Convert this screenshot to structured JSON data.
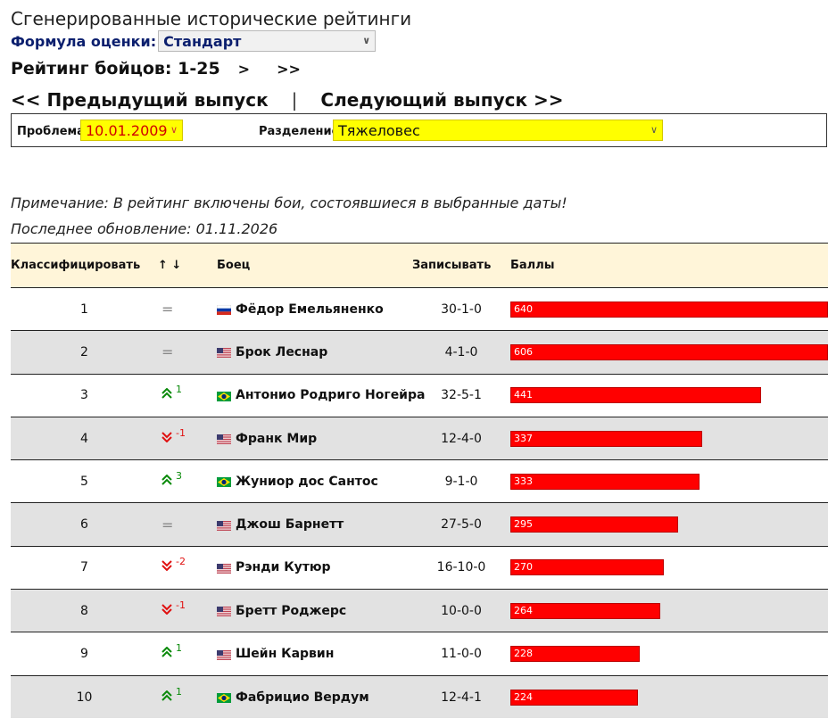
{
  "page": {
    "title": "Сгенерированные исторические рейтинги",
    "formula_label": "Формула оценки:",
    "formula_value": "Стандарт",
    "ranking_title": "Рейтинг бойцов: 1-25",
    "nav_next": ">",
    "nav_last": ">>",
    "prev_issue": "<< Предыдущий выпуск",
    "separator": "|",
    "next_issue": "Следующий выпуск >>"
  },
  "filters": {
    "issue_label": "Проблема",
    "issue_value": "10.01.2009",
    "division_label": "Разделение",
    "division_value": "Тяжеловес"
  },
  "notes": {
    "note": "Примечание: В рейтинг включены бои, состоявшиеся в выбранные даты!",
    "updated": "Последнее обновление: 01.11.2026"
  },
  "table": {
    "headers": {
      "rank": "Классифицировать",
      "move": "↑ ↓",
      "fighter": "Боец",
      "record": "Записывать",
      "points": "Баллы"
    },
    "rows": [
      {
        "rank": "1",
        "move": "same",
        "move_value": "",
        "country": "RU",
        "fighter": "Фёдор Емельяненко",
        "record": "30-1-0",
        "points": "640",
        "points_num": 640
      },
      {
        "rank": "2",
        "move": "same",
        "move_value": "",
        "country": "US",
        "fighter": "Брок Леснар",
        "record": "4-1-0",
        "points": "606",
        "points_num": 606
      },
      {
        "rank": "3",
        "move": "up",
        "move_value": "1",
        "country": "BR",
        "fighter": "Антонио Родриго Ногейра",
        "record": "32-5-1",
        "points": "441",
        "points_num": 441
      },
      {
        "rank": "4",
        "move": "down",
        "move_value": "-1",
        "country": "US",
        "fighter": "Франк Мир",
        "record": "12-4-0",
        "points": "337",
        "points_num": 337
      },
      {
        "rank": "5",
        "move": "up",
        "move_value": "3",
        "country": "BR",
        "fighter": "Жуниор дос Сантос",
        "record": "9-1-0",
        "points": "333",
        "points_num": 333
      },
      {
        "rank": "6",
        "move": "same",
        "move_value": "",
        "country": "US",
        "fighter": "Джош Барнетт",
        "record": "27-5-0",
        "points": "295",
        "points_num": 295
      },
      {
        "rank": "7",
        "move": "down",
        "move_value": "-2",
        "country": "US",
        "fighter": "Рэнди Кутюр",
        "record": "16-10-0",
        "points": "270",
        "points_num": 270
      },
      {
        "rank": "8",
        "move": "down",
        "move_value": "-1",
        "country": "US",
        "fighter": "Бретт Роджерс",
        "record": "10-0-0",
        "points": "264",
        "points_num": 264
      },
      {
        "rank": "9",
        "move": "up",
        "move_value": "1",
        "country": "US",
        "fighter": "Шейн Карвин",
        "record": "11-0-0",
        "points": "228",
        "points_num": 228
      },
      {
        "rank": "10",
        "move": "up",
        "move_value": "1",
        "country": "BR",
        "fighter": "Фабрицио Вердум",
        "record": "12-4-1",
        "points": "224",
        "points_num": 224
      }
    ]
  },
  "colors": {
    "header_bg": "#fff5d9",
    "bar": "#ff0000",
    "select_highlight": "#ffff00",
    "up": "#0a8a0a",
    "down": "#e01010"
  }
}
